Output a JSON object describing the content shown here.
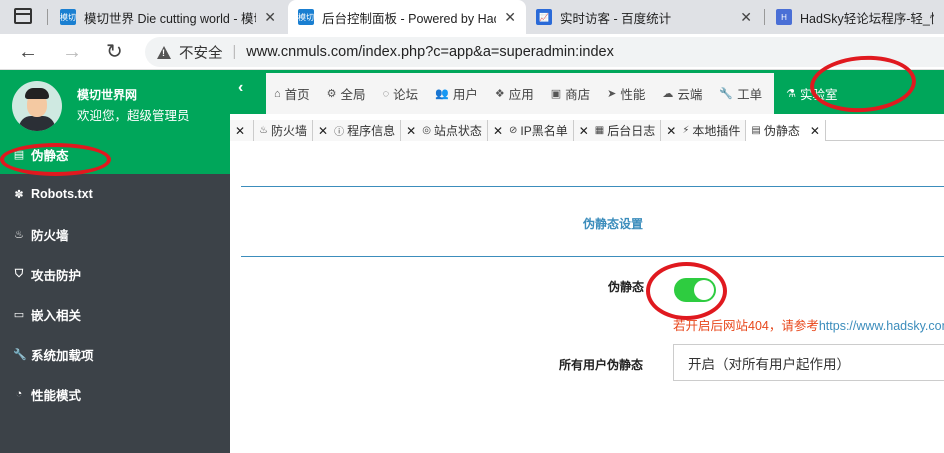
{
  "browser": {
    "tabs": [
      {
        "title": "模切世界 Die cutting world - 模切",
        "favicon": "模切"
      },
      {
        "title": "后台控制面板 - Powered by HadSky",
        "favicon": "模切"
      },
      {
        "title": "实时访客 - 百度统计",
        "favicon": "chart-icon"
      },
      {
        "title": "HadSky轻论坛程序-轻_快_简",
        "favicon": "hadsky-icon"
      }
    ],
    "security_label": "不安全",
    "url": "www.cnmuls.com/index.php?c=app&a=superadmin:index"
  },
  "sidebar": {
    "site_name": "模切世界网",
    "welcome": "欢迎您，超级管理员",
    "items": [
      {
        "label": "伪静态",
        "icon": "file-icon"
      },
      {
        "label": "Robots.txt",
        "icon": "paw-icon"
      },
      {
        "label": "防火墙",
        "icon": "fire-icon"
      },
      {
        "label": "攻击防护",
        "icon": "shield-icon"
      },
      {
        "label": "嵌入相关",
        "icon": "inbox-icon"
      },
      {
        "label": "系统加载项",
        "icon": "wrench-icon"
      },
      {
        "label": "性能模式",
        "icon": "dashboard-icon"
      }
    ]
  },
  "topnav": {
    "collapse": "‹",
    "items": [
      {
        "label": "首页",
        "icon": "home-icon"
      },
      {
        "label": "全局",
        "icon": "cogs-icon"
      },
      {
        "label": "论坛",
        "icon": "comments-icon"
      },
      {
        "label": "用户",
        "icon": "users-icon"
      },
      {
        "label": "应用",
        "icon": "cubes-icon"
      },
      {
        "label": "商店",
        "icon": "shop-icon"
      },
      {
        "label": "性能",
        "icon": "send-icon"
      },
      {
        "label": "云端",
        "icon": "cloud-icon"
      },
      {
        "label": "工单",
        "icon": "wrench-icon"
      },
      {
        "label": "实验室",
        "icon": "flask-icon"
      }
    ]
  },
  "subtabs": [
    {
      "label": "防火墙",
      "icon": "fire-icon"
    },
    {
      "label": "程序信息",
      "icon": "info-icon"
    },
    {
      "label": "站点状态",
      "icon": "status-icon"
    },
    {
      "label": "IP黑名单",
      "icon": "ban-icon"
    },
    {
      "label": "后台日志",
      "icon": "calendar-icon"
    },
    {
      "label": "本地插件",
      "icon": "plug-icon"
    },
    {
      "label": "伪静态",
      "icon": "file-icon"
    }
  ],
  "content": {
    "section_title": "伪静态设置",
    "rewrite_label": "伪静态",
    "rewrite_enabled": true,
    "hint_text": "若开启后网站404，请参考",
    "hint_link": "https://www.hadsky.com",
    "all_users_label": "所有用户伪静态",
    "all_users_value": "开启（对所有用户起作用）"
  },
  "colors": {
    "brand_green": "#00a65a",
    "sidebar_bg": "#3c4248",
    "toggle_on": "#2ecc40",
    "accent_blue": "#3c8dbc",
    "hint_red": "#e8481c",
    "annotation_red": "#e0191f"
  }
}
